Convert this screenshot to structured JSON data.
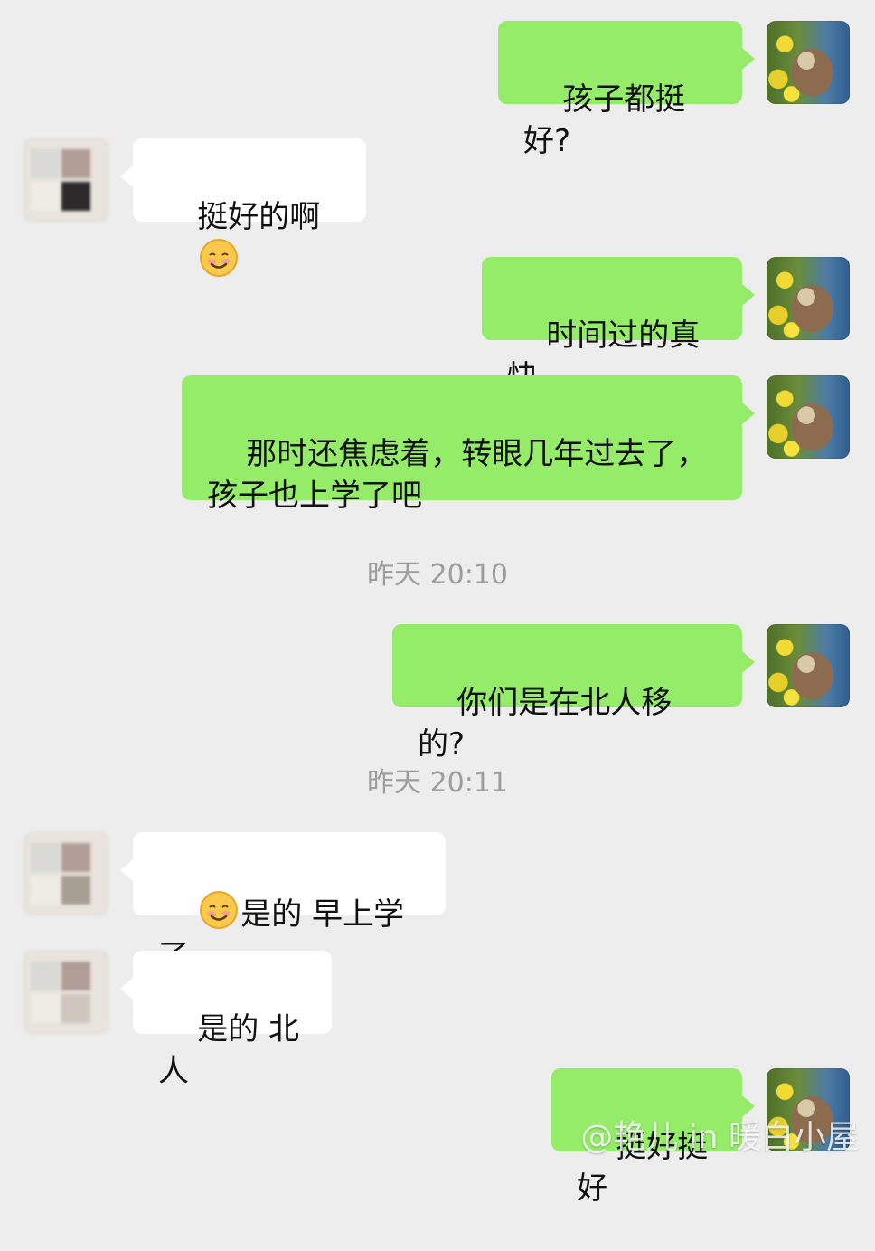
{
  "messages": [
    {
      "text": "孩子都挺好?"
    },
    {
      "text": "挺好的啊"
    },
    {
      "text": "时间过的真快"
    },
    {
      "text": "那时还焦虑着，转眼几年过去了，\n孩子也上学了吧"
    },
    {
      "text": "你们是在北人移的?"
    },
    {
      "text": "是的 早上学了"
    },
    {
      "text": "是的 北人"
    },
    {
      "text": "挺好挺好"
    }
  ],
  "timestamps": [
    "昨天 20:10",
    "昨天 20:11"
  ],
  "watermark": "@艳儿 in 暖白小屋",
  "colors": {
    "self_bubble": "#95ec69",
    "other_bubble": "#ffffff",
    "background": "#ededed",
    "timestamp": "#9d9d9d"
  }
}
